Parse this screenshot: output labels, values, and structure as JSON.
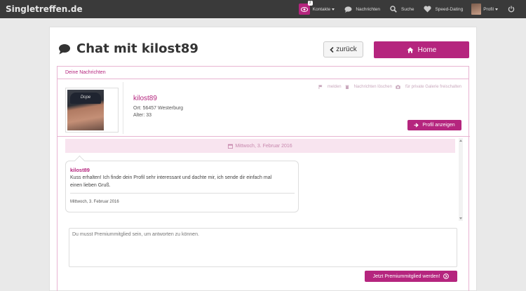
{
  "navbar": {
    "brand": "Singletreffen.de",
    "items": [
      {
        "label": "Kontakte",
        "badge": "2"
      },
      {
        "label": "Nachrichten"
      },
      {
        "label": "Suche"
      },
      {
        "label": "Speed-Dating"
      },
      {
        "label": "Profil"
      }
    ]
  },
  "page": {
    "title": "Chat mit kilost89",
    "back_label": "zurück",
    "home_label": "Home"
  },
  "section": {
    "header": "Deine Nachrichten"
  },
  "profile": {
    "name": "kilost89",
    "ort": "Ort: 56457 Westerburg",
    "alter": "Alter: 33",
    "cap_text": "Dope",
    "actions": {
      "melden": "melden",
      "loeschen": "Nachrichten löschen",
      "galerie": "für private Galerie freischalten"
    },
    "profil_button": "Profil anzeigen"
  },
  "messages": {
    "date_header": "Mittwoch, 3. Februar 2016",
    "items": [
      {
        "sender": "kilost89",
        "text": "Kuss erhalten! Ich finde dein Profil sehr interessant und dachte mir, ich sende dir einfach mal einen lieben Gruß.",
        "date": "Mittwoch, 3. Februar 2016"
      }
    ]
  },
  "reply": {
    "placeholder": "Du musst Premiummitglied sein, um antworten zu können.",
    "premium_button": "Jetzt Premiummitglied werden!"
  },
  "colors": {
    "accent": "#b5257e",
    "navbar": "#3a3a3a",
    "date_bar": "#f8e4ef"
  }
}
